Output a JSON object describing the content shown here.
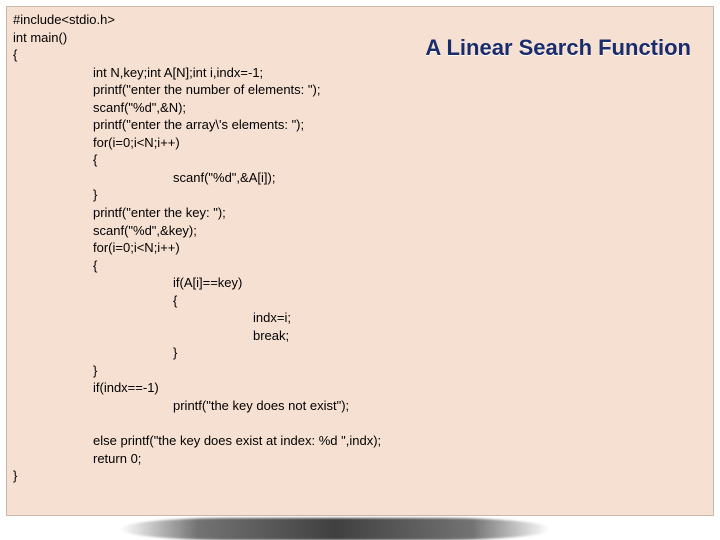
{
  "title": "A Linear Search Function",
  "code": {
    "l01": "#include<stdio.h>",
    "l02": "int main()",
    "l03": "{",
    "l04": "int N,key;int A[N];int i,indx=-1;",
    "l05": "printf(\"enter the number of elements: \");",
    "l06": "scanf(\"%d\",&N);",
    "l07": "printf(\"enter the array\\'s elements: \");",
    "l08": "for(i=0;i<N;i++)",
    "l09": "{",
    "l10": "scanf(\"%d\",&A[i]);",
    "l11": "}",
    "l12": "printf(\"enter the key: \");",
    "l13": "scanf(\"%d\",&key);",
    "l14": "for(i=0;i<N;i++)",
    "l15": "{",
    "l16": "if(A[i]==key)",
    "l17": "{",
    "l18": "indx=i;",
    "l19": "break;",
    "l20": "}",
    "l21": "}",
    "l22": "if(indx==-1)",
    "l23": "printf(\"the key does not exist\");",
    "l24_blank": "",
    "l25": "else printf(\"the key does exist at index: %d \",indx);",
    "l26": "return 0;",
    "l27": "}"
  }
}
